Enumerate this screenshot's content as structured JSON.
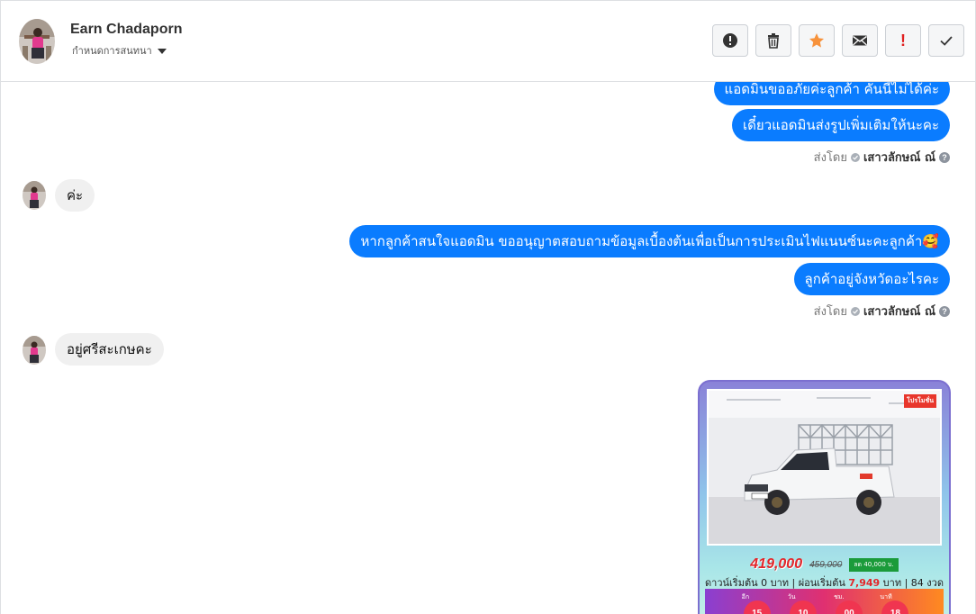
{
  "header": {
    "name": "Earn Chadaporn",
    "subtitle": "กำหนดการสนทนา"
  },
  "toolbar": {
    "icons": [
      "alert-circle-icon",
      "trash-icon",
      "star-icon",
      "envelope-icon",
      "exclamation-icon",
      "check-icon"
    ],
    "exclamation_text": "!",
    "colors": {
      "star": "#f7923b",
      "exclamation": "#e02020"
    }
  },
  "messages": [
    {
      "dir": "out",
      "text": "แอดมินขออภัยค่ะลูกค้า คันนี้ไม่ได้ค่ะ"
    },
    {
      "dir": "out",
      "text": "เดี๋ยวแอดมินส่งรูปเพิ่มเติมให้นะคะ"
    },
    {
      "dir": "in",
      "text": "ค่ะ"
    },
    {
      "dir": "out",
      "text": "หากลูกค้าสนใจแอดมิน ขออนุญาตสอบถามข้อมูลเบื้องต้นเพื่อเป็นการประเมินไฟแนนซ์นะคะลูกค้า🥰"
    },
    {
      "dir": "out",
      "text": "ลูกค้าอยู่จังหวัดอะไรคะ"
    },
    {
      "dir": "in",
      "text": "อยู่ศรีสะเกษคะ"
    }
  ],
  "sent_by": {
    "prefix": "ส่งโดย",
    "name": "เสาวลักษณ์ ณ์",
    "help": "?"
  },
  "promo": {
    "tag": "โปรโมชั่น",
    "price": "419,000",
    "old_price": "459,000",
    "discount": "ลด 40,000 บ.",
    "terms_prefix": "ดาวน์เริ่มต้น 0 บาท | ผ่อนเริ่มต้น",
    "installment": "7,949",
    "terms_suffix": "บาท | 84 งวด",
    "countdown": [
      {
        "label": "อีก",
        "value": "15"
      },
      {
        "label": "วัน",
        "value": "10"
      },
      {
        "label": "ชม.",
        "value": "00"
      },
      {
        "label": "นาที",
        "value": "18"
      }
    ]
  },
  "bubble_color": "#0a7cff"
}
